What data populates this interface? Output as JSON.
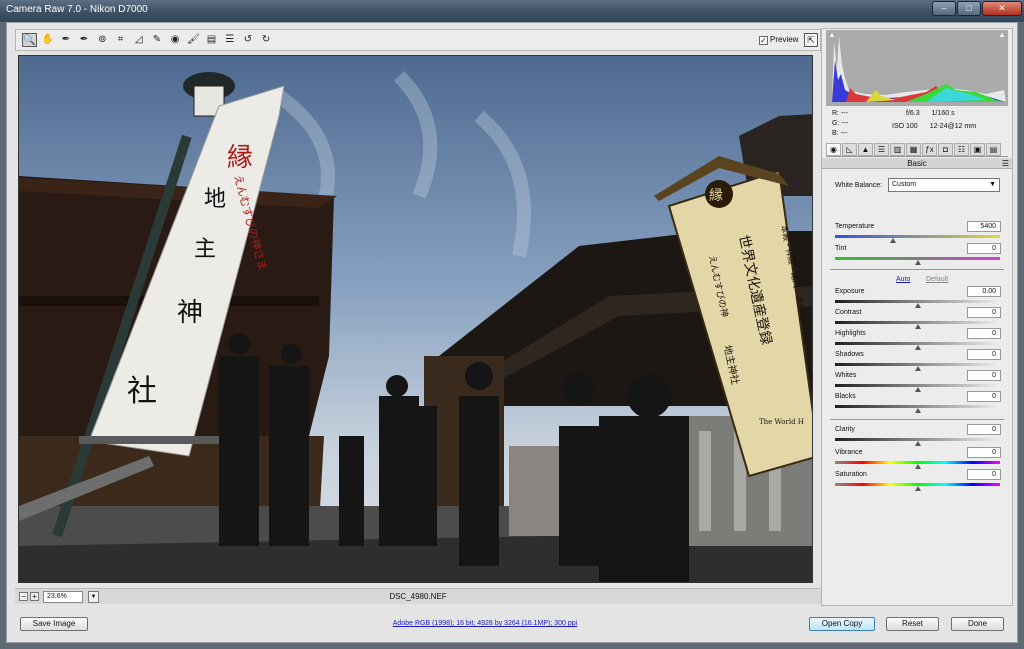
{
  "window": {
    "title": "Camera Raw 7.0  -  Nikon D7000",
    "min": "–",
    "max": "□",
    "close": "✕"
  },
  "toolbar": {
    "tools": [
      {
        "name": "zoom-tool-icon",
        "glyph": "🔍",
        "selected": true
      },
      {
        "name": "hand-tool-icon",
        "glyph": "✋"
      },
      {
        "name": "white-balance-tool-icon",
        "glyph": "✒"
      },
      {
        "name": "color-sampler-tool-icon",
        "glyph": "✒"
      },
      {
        "name": "targeted-adjustment-tool-icon",
        "glyph": "⊚"
      },
      {
        "name": "crop-tool-icon",
        "glyph": "⌗"
      },
      {
        "name": "straighten-tool-icon",
        "glyph": "◿"
      },
      {
        "name": "spot-removal-tool-icon",
        "glyph": "✎"
      },
      {
        "name": "red-eye-tool-icon",
        "glyph": "◉"
      },
      {
        "name": "adjustment-brush-icon",
        "glyph": "🖌"
      },
      {
        "name": "graduated-filter-icon",
        "glyph": "▤"
      },
      {
        "name": "preferences-icon",
        "glyph": "☰"
      },
      {
        "name": "rotate-left-icon",
        "glyph": "↺"
      },
      {
        "name": "rotate-right-icon",
        "glyph": "↻"
      }
    ],
    "preview_label": "Preview",
    "preview_checked": "✓",
    "fullscreen": "⇱"
  },
  "status": {
    "zoom_out": "−",
    "zoom_in": "+",
    "zoom_value": "23.6%",
    "zoom_dropdown": "▼",
    "filename": "DSC_4980.NEF"
  },
  "info": {
    "r_label": "R:",
    "r": "---",
    "g_label": "G:",
    "g": "---",
    "b_label": "B:",
    "b": "---",
    "aperture": "f/6.3",
    "shutter": "1/160 s",
    "iso": "ISO 100",
    "lens": "12-24@12 mm"
  },
  "panel": {
    "tabs": [
      "◉",
      "◺",
      "▲",
      "☰",
      "▥",
      "▦",
      "ƒx",
      "◘",
      "☷",
      "▣",
      "▤"
    ],
    "title": "Basic",
    "menu_icon": "☰",
    "wb_label": "White Balance:",
    "wb_value": "Custom",
    "wb_arrow": "▼",
    "auto": "Auto",
    "default": "Default",
    "sliders": [
      {
        "label": "Temperature",
        "value": "5400",
        "level": 0.35,
        "track": "temp"
      },
      {
        "label": "Tint",
        "value": "0",
        "level": 0.5,
        "track": "tint"
      },
      {
        "label": "Exposure",
        "value": "0.00",
        "level": 0.5,
        "track": "gray"
      },
      {
        "label": "Contrast",
        "value": "0",
        "level": 0.5,
        "track": "gray"
      },
      {
        "label": "Highlights",
        "value": "0",
        "level": 0.5,
        "track": "gray"
      },
      {
        "label": "Shadows",
        "value": "0",
        "level": 0.5,
        "track": "gray"
      },
      {
        "label": "Whites",
        "value": "0",
        "level": 0.5,
        "track": "gray"
      },
      {
        "label": "Blacks",
        "value": "0",
        "level": 0.5,
        "track": "gray"
      },
      {
        "label": "Clarity",
        "value": "0",
        "level": 0.5,
        "track": "gray"
      },
      {
        "label": "Vibrance",
        "value": "0",
        "level": 0.5,
        "track": "vib"
      },
      {
        "label": "Saturation",
        "value": "0",
        "level": 0.5,
        "track": "sat"
      }
    ]
  },
  "footer": {
    "save": "Save Image",
    "workflow": "Adobe RGB (1998); 16 bit; 4928 by 3264 (16.1MP); 300 ppi",
    "open": "Open Copy",
    "reset": "Reset",
    "done": "Done"
  },
  "photo": {
    "kanji_banner": "縁",
    "kanji_col1": "地",
    "kanji_col2": "主",
    "kanji_col3": "神",
    "kanji_col4": "社",
    "banner_red": "えんむすびの神さま",
    "sign_top": "縁",
    "sign_text1": "世界文化遺産登録",
    "sign_text2": "本殿・拝殿・総門・境内地",
    "sign_text3": "地主神社",
    "sign_text4": "えんむすびの神",
    "sign_small": "The World H"
  }
}
